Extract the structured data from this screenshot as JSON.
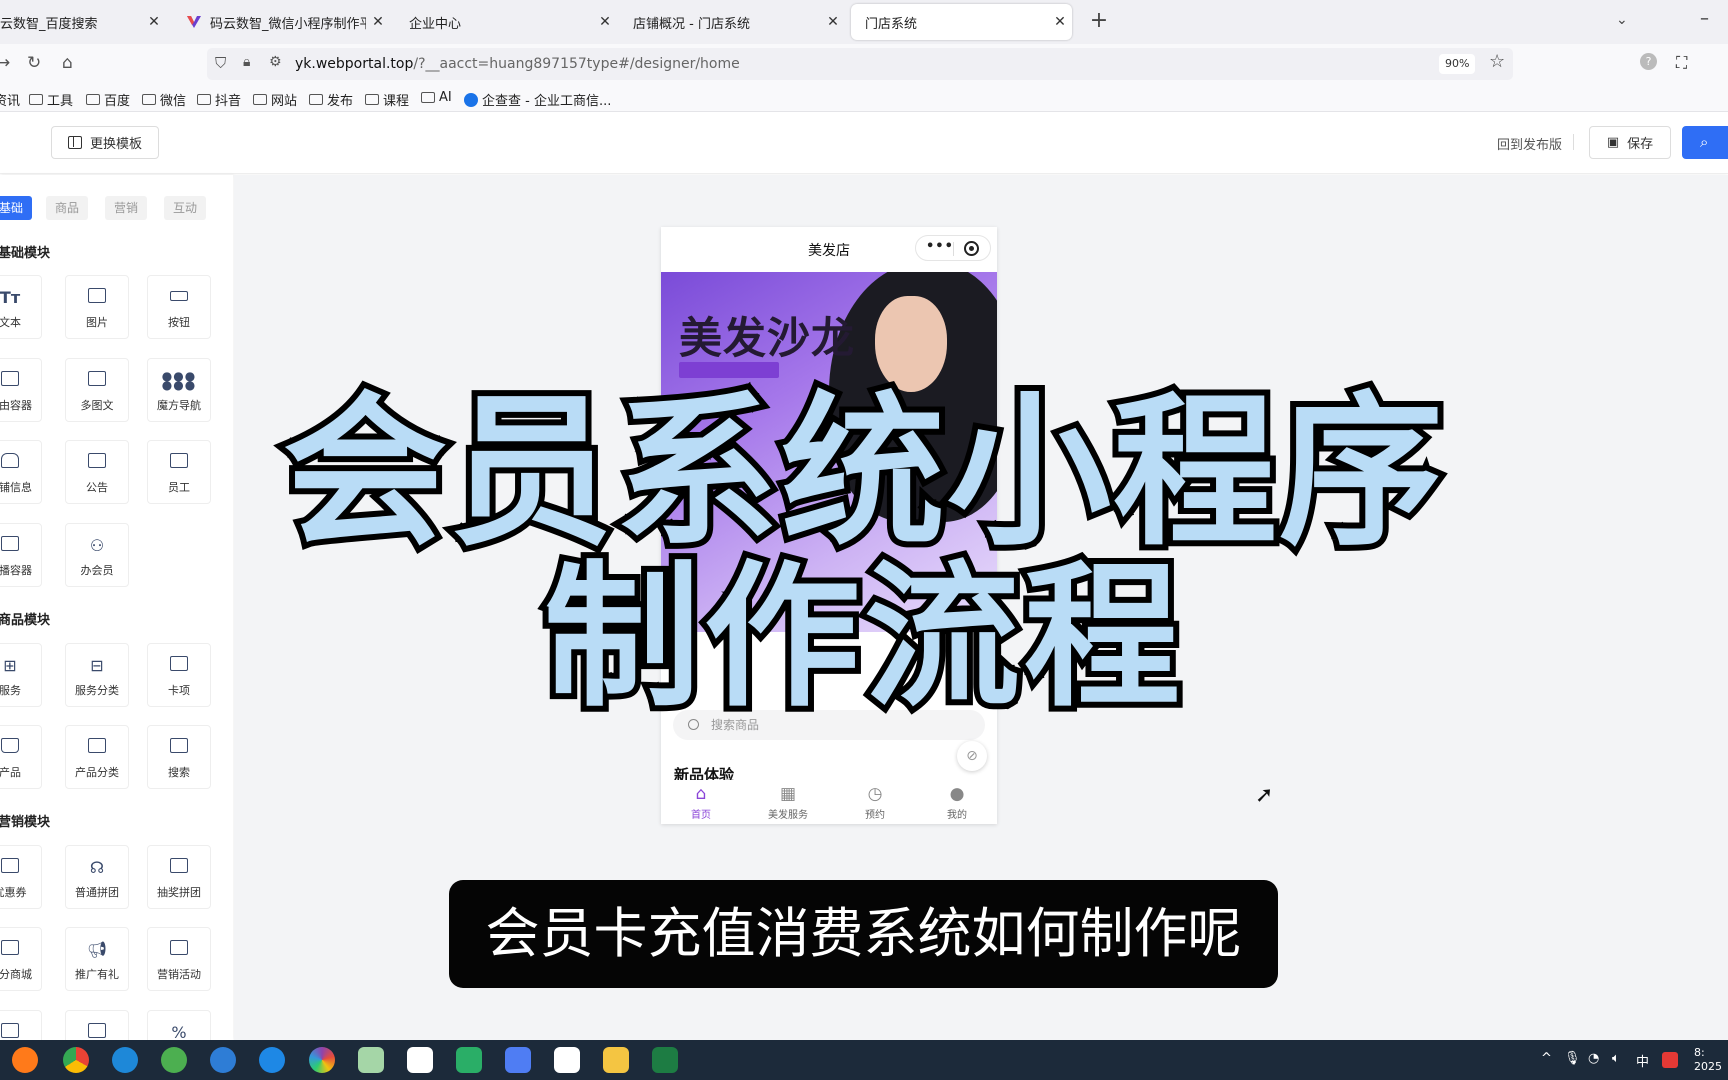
{
  "browser": {
    "tabs": [
      {
        "title": "云数智_百度搜索",
        "active": false
      },
      {
        "title": "码云数智_微信小程序制作平台_",
        "active": false
      },
      {
        "title": "企业中心",
        "active": false
      },
      {
        "title": "店铺概况 - 门店系统",
        "active": false
      },
      {
        "title": "门店系统",
        "active": true
      }
    ],
    "new_tab_label": "+",
    "url_host": "yk.webportal.top",
    "url_path": "/?__aacct=huang897157type#/designer/home",
    "zoom": "90%",
    "bookmarks": [
      "资讯",
      "工具",
      "百度",
      "微信",
      "抖音",
      "网站",
      "发布",
      "课程",
      "AI",
      "企查查 - 企业工商信..."
    ]
  },
  "header": {
    "template_button": "更换模板",
    "back_to_published": "回到发布版",
    "save_button": "保存"
  },
  "sidebar": {
    "tabs": [
      "基础",
      "商品",
      "营销",
      "互动"
    ],
    "active_tab": "基础",
    "sections": [
      {
        "title": "基础模块",
        "items": [
          "文本",
          "图片",
          "按钮",
          "自由容器",
          "多图文",
          "魔方导航",
          "店铺信息",
          "公告",
          "员工",
          "轮播容器",
          "办会员"
        ]
      },
      {
        "title": "商品模块",
        "items": [
          "服务",
          "服务分类",
          "卡项",
          "产品",
          "产品分类",
          "搜索"
        ]
      },
      {
        "title": "营销模块",
        "items": [
          "优惠券",
          "普通拼团",
          "抽奖拼团",
          "积分商城",
          "推广有礼",
          "营销活动"
        ]
      }
    ]
  },
  "phone": {
    "title": "美发店",
    "banner_text": "美发沙龙",
    "search_placeholder": "搜索商品",
    "section_title": "新品体验",
    "nav": [
      {
        "label": "首页",
        "active": true
      },
      {
        "label": "美发服务",
        "active": false
      },
      {
        "label": "预约",
        "active": false
      },
      {
        "label": "我的",
        "active": false
      }
    ]
  },
  "overlay": {
    "title_line1": "会员系统小程序",
    "title_line2": "制作流程",
    "subtitle": "会员卡充值消费系统如何制作呢"
  },
  "taskbar": {
    "ime": "中",
    "clock": "8: 2025"
  },
  "colors": {
    "accent_blue": "#2f6ef5",
    "phone_accent": "#8b45d8",
    "overlay_text": "#b9dcf6"
  }
}
